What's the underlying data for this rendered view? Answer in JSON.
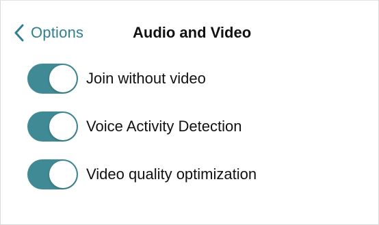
{
  "nav": {
    "back_label": "Options",
    "title": "Audio and Video"
  },
  "options": [
    {
      "label": "Join without video",
      "enabled": true
    },
    {
      "label": "Voice Activity Detection",
      "enabled": true
    },
    {
      "label": "Video quality optimization",
      "enabled": true
    }
  ],
  "colors": {
    "accent": "#2f7f8f",
    "switch_on": "#3f8a94"
  },
  "icons": {
    "back": "chevron-left-icon"
  }
}
